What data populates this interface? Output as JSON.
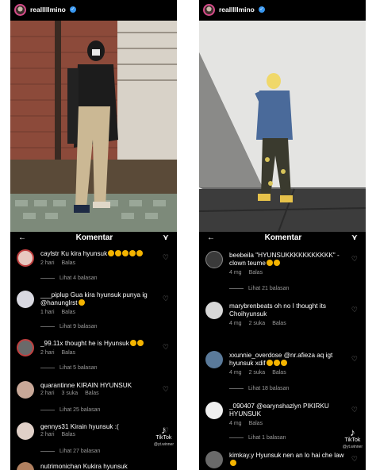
{
  "top_left": {
    "username": "realllllmino"
  },
  "top_right": {
    "username": "realllllmino"
  },
  "left_comments": {
    "header_title": "Komentar",
    "items": [
      {
        "user": "caylstr",
        "text": "Ku kira hyunsuk",
        "time": "2 hari",
        "likes": "",
        "reply": "Balas",
        "replies_label": "Lihat 4 balasan"
      },
      {
        "user": "___piplup",
        "text": "Gua kira hyunsuk punya ig @hanunglrst",
        "time": "1 hari",
        "likes": "",
        "reply": "Balas",
        "replies_label": "Lihat 9 balasan"
      },
      {
        "user": "_99.11x",
        "text": "thought he is Hyunsuk",
        "time": "2 hari",
        "likes": "",
        "reply": "Balas",
        "replies_label": "Lihat 5 balasan"
      },
      {
        "user": "quarantinne",
        "text": "KIRAIN HYUNSUK",
        "time": "2 hari",
        "likes": "3 suka",
        "reply": "Balas",
        "replies_label": "Lihat 25 balasan"
      },
      {
        "user": "gennys31",
        "text": "Kirain hyunsuk :(",
        "time": "2 hari",
        "likes": "",
        "reply": "Balas",
        "replies_label": "Lihat 27 balasan"
      },
      {
        "user": "nutrimonichan",
        "text": "Kukira hyunsuk",
        "time": "",
        "likes": "",
        "reply": "",
        "replies_label": ""
      }
    ]
  },
  "right_comments": {
    "header_title": "Komentar",
    "items": [
      {
        "user": "beebeila",
        "text": "\"HYUNSUKKKKKKKKKKK\" - clown teume",
        "time": "4 mg",
        "likes": "",
        "reply": "Balas",
        "replies_label": "Lihat 21 balasan"
      },
      {
        "user": "marybrenbeats",
        "text": "oh no I thought its Choihyunsuk",
        "time": "4 mg",
        "likes": "2 suka",
        "reply": "Balas",
        "replies_label": ""
      },
      {
        "user": "xxunnie_overdose",
        "text": "@nr.afieza aq igt hyunsuk xdif",
        "time": "4 mg",
        "likes": "2 suka",
        "reply": "Balas",
        "replies_label": "Lihat 18 balasan"
      },
      {
        "user": "_090407",
        "text": "@earynshazlyn PIKIRKU HYUNSUK",
        "time": "4 mg",
        "likes": "",
        "reply": "Balas",
        "replies_label": "Lihat 1 balasan"
      },
      {
        "user": "kimkay.y",
        "text": "Hyunsuk nen an lo hai che law",
        "time": "",
        "likes": "",
        "reply": "",
        "replies_label": ""
      }
    ]
  },
  "tiktok": {
    "brand": "TikTok",
    "handle": "@yt.winner"
  },
  "colors": {
    "panel_bg": "#000000",
    "muted": "#9a9a9a",
    "verified": "#3897f0",
    "emoji": "#f4b400"
  }
}
